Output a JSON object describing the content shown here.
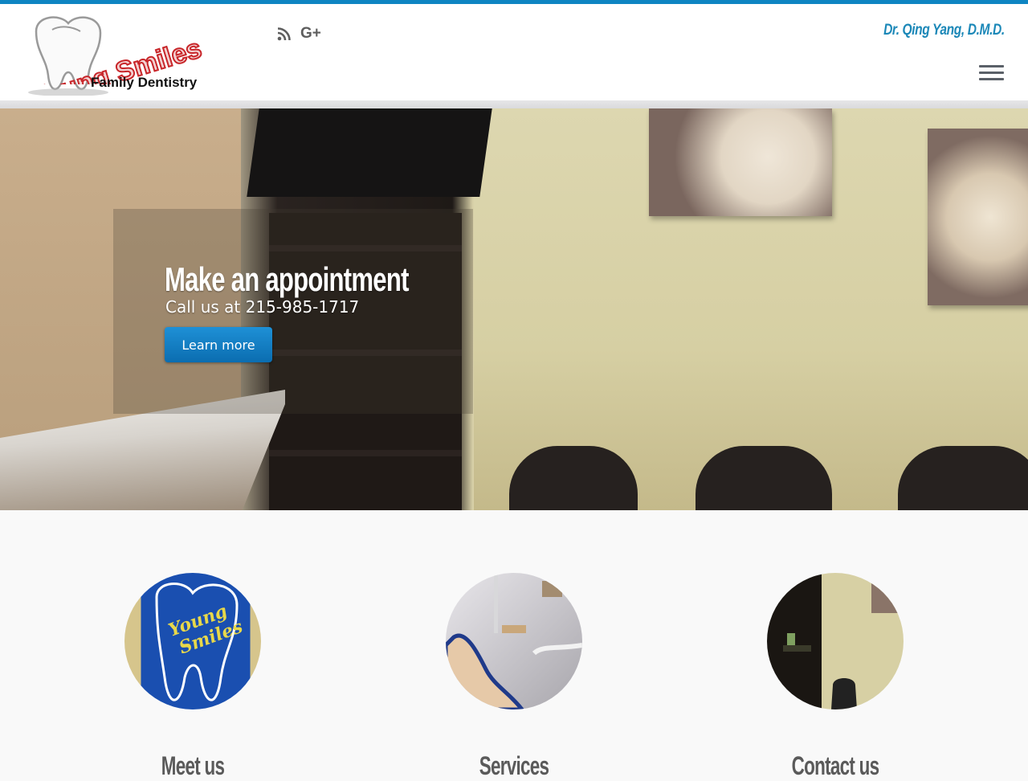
{
  "header": {
    "logo": {
      "brand": "Young Smiles",
      "tagline": "Family Dentistry"
    },
    "social": [
      {
        "name": "rss-icon",
        "glyph": "rss"
      },
      {
        "name": "google-plus-icon",
        "glyph": "G+"
      }
    ],
    "doctor_name": "Dr. Qing Yang, D.M.D.",
    "menu_icon": "hamburger-menu-icon",
    "accent_color": "#0e85c2"
  },
  "hero": {
    "title": "Make an appointment",
    "subtitle": "Call us at 215-985-1717",
    "button_label": "Learn more",
    "button_color": "#1581c8"
  },
  "features": [
    {
      "title": "Meet us",
      "image": "Young Smiles tooth sign"
    },
    {
      "title": "Services",
      "image": "dental chair"
    },
    {
      "title": "Contact us",
      "image": "waiting room"
    }
  ]
}
